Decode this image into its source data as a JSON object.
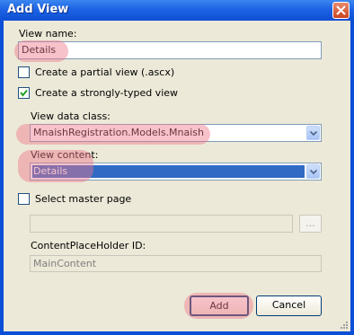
{
  "window": {
    "title": "Add View"
  },
  "view_name": {
    "label": "View name:",
    "value": "Details"
  },
  "partial_view": {
    "label": "Create a partial view (.ascx)",
    "checked": false
  },
  "strongly_typed": {
    "label": "Create a strongly-typed view",
    "checked": true
  },
  "view_data_class": {
    "label": "View data class:",
    "value": "MnaishRegistration.Models.Mnaish"
  },
  "view_content": {
    "label": "View content:",
    "value": "Details"
  },
  "master_page": {
    "label": "Select master page",
    "checked": false,
    "path": "",
    "browse_label": "..."
  },
  "content_placeholder": {
    "label": "ContentPlaceHolder ID:",
    "value": "MainContent"
  },
  "buttons": {
    "add": "Add",
    "cancel": "Cancel"
  },
  "colors": {
    "highlight": "#f0788c",
    "selection": "#316ac5",
    "titlebar": "#1d63e5"
  }
}
